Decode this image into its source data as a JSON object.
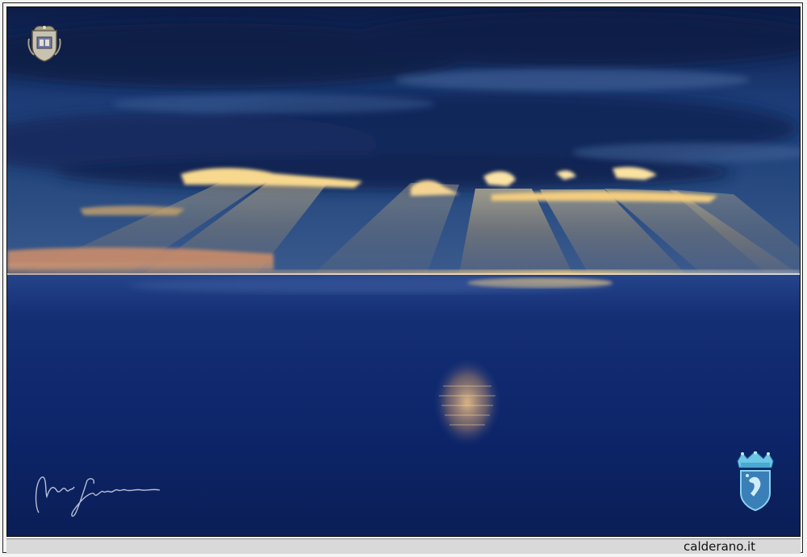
{
  "footer": {
    "site_label": "calderano.it"
  },
  "photo": {
    "icons": {
      "top_left": "coat-of-arms-icon",
      "bottom_right": "crowned-shield-icon",
      "bottom_left": "signature-icon"
    },
    "colors": {
      "sky_dark": "#0e2150",
      "sky_mid": "#22467f",
      "sea_dark": "#0a2263",
      "sea_mid": "#183a86",
      "sun_glow": "#f3c46a",
      "horizon_light": "#e9c27d"
    }
  }
}
